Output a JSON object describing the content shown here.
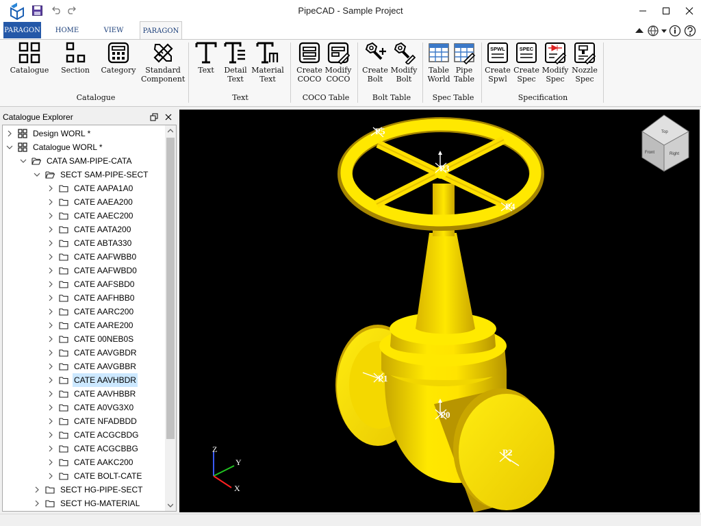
{
  "window": {
    "title": "PipeCAD - Sample Project"
  },
  "tabs": {
    "file": "PARAGON",
    "home": "HOME",
    "view": "VIEW",
    "paragon": "PARAGON"
  },
  "ribbon": {
    "buttons": {
      "catalogue": "Catalogue",
      "section": "Section",
      "category": "Category",
      "standard_component": "Standard\nComponent",
      "text": "Text",
      "detail_text": "Detail\nText",
      "material_text": "Material\nText",
      "create_coco": "Create\nCOCO",
      "modify_coco": "Modify\nCOCO",
      "create_bolt": "Create\nBolt",
      "modify_bolt": "Modify\nBolt",
      "table_world": "Table\nWorld",
      "pipe_table": "Pipe\nTable",
      "create_spwl": "Create\nSpwl",
      "create_spec": "Create\nSpec",
      "modify_spec": "Modify\nSpec",
      "nozzle_spec": "Nozzle\nSpec"
    },
    "groups": {
      "catalogue": "Catalogue",
      "text": "Text",
      "coco_table": "COCO Table",
      "bolt_table": "Bolt Table",
      "spec_table": "Spec Table",
      "specification": "Specification"
    },
    "icon_badges": {
      "spwl": "SPWL",
      "spec": "SPEC"
    }
  },
  "explorer": {
    "title": "Catalogue Explorer",
    "design_root": "Design WORL *",
    "catalogue_root": "Catalogue WORL *",
    "cata": "CATA SAM-PIPE-CATA",
    "sect": "SECT SAM-PIPE-SECT",
    "cates": [
      "CATE AAPA1A0",
      "CATE AAEA200",
      "CATE AAEC200",
      "CATE AATA200",
      "CATE ABTA330",
      "CATE AAFWBB0",
      "CATE AAFWBD0",
      "CATE AAFSBD0",
      "CATE AAFHBB0",
      "CATE AARC200",
      "CATE AARE200",
      "CATE 00NEB0S",
      "CATE AAVGBDR",
      "CATE AAVGBBR",
      "CATE AAVHBDR",
      "CATE AAVHBBR",
      "CATE A0VG3X0",
      "CATE NFADBDD",
      "CATE ACGCBDG",
      "CATE ACGCBBG",
      "CATE AAKC200",
      "CATE BOLT-CATE"
    ],
    "selected_index": 14,
    "sect_hg_pipe": "SECT HG-PIPE-SECT",
    "sect_hg_material": "SECT HG-MATERIAL"
  },
  "viewport": {
    "model_color": "#ffe800",
    "background": "#000000",
    "points": {
      "p0": "P0",
      "p1": "P1",
      "p2": "P2",
      "p3": "P3",
      "p4": "P4",
      "p5": "P5"
    },
    "axes": {
      "z": "Z",
      "y": "Y",
      "x": "X"
    },
    "viewcube": {
      "top": "Top",
      "front": "Front",
      "right": "Right"
    }
  },
  "colors": {
    "accent": "#2458a8",
    "selection": "#cce8ff"
  }
}
